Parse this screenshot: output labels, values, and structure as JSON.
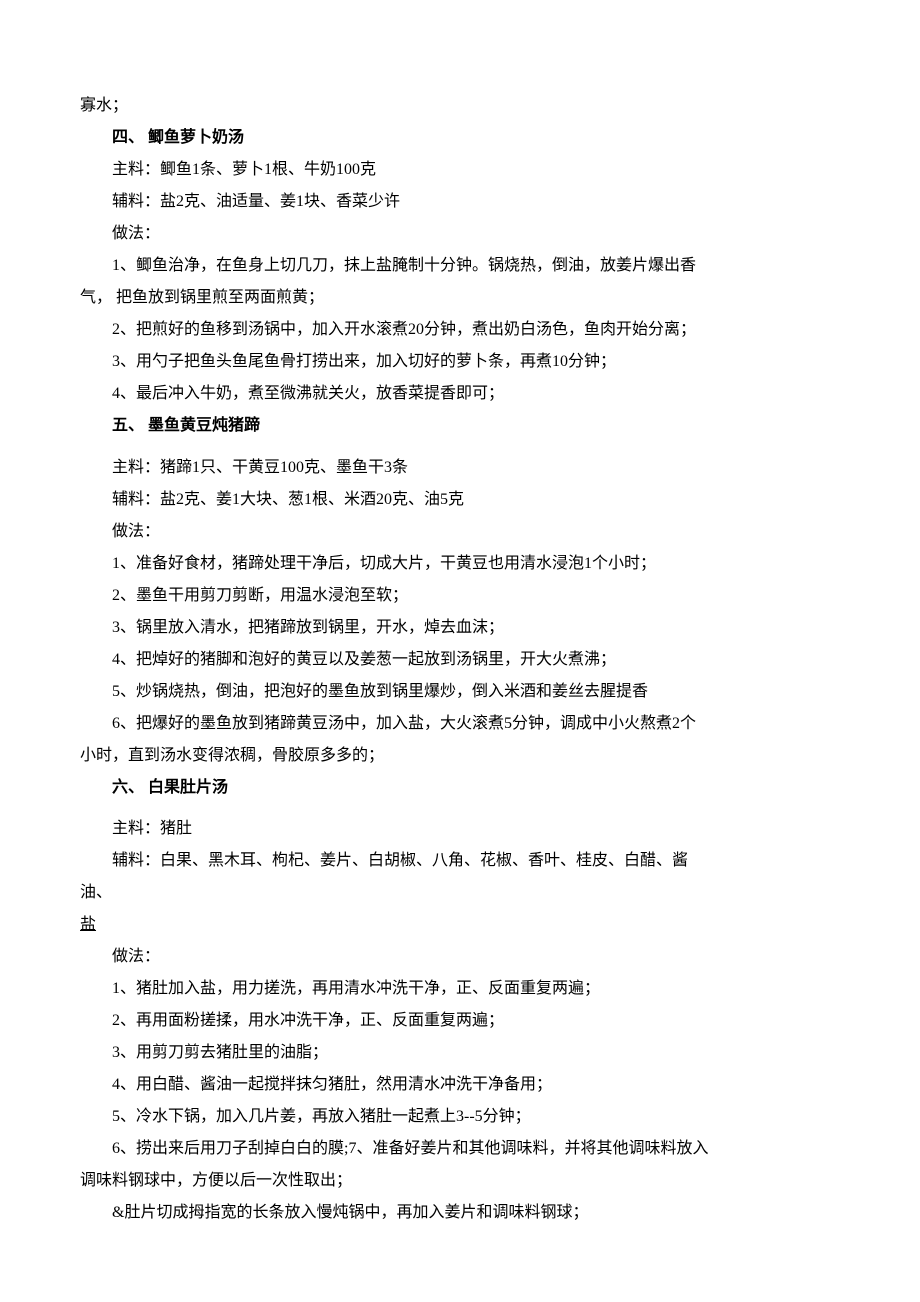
{
  "fragment_top": "寡水；",
  "section4": {
    "title": "四、   鲫鱼萝卜奶汤",
    "main": "主料：鲫鱼1条、萝卜1根、牛奶100克",
    "aux": "辅料：盐2克、油适量、姜1块、香菜少许",
    "method_label": "做法：",
    "steps": [
      "1、鲫鱼治净，在鱼身上切几刀，抹上盐腌制十分钟。锅烧热，倒油，放姜片爆出香",
      "气，  把鱼放到锅里煎至两面煎黄；",
      "2、把煎好的鱼移到汤锅中，加入开水滚煮20分钟，煮出奶白汤色，鱼肉开始分离；",
      "3、用勺子把鱼头鱼尾鱼骨打捞出来，加入切好的萝卜条，再煮10分钟；",
      "4、最后冲入牛奶，煮至微沸就关火，放香菜提香即可；"
    ]
  },
  "section5": {
    "title": "五、   墨鱼黄豆炖猪蹄",
    "main": "主料：猪蹄1只、干黄豆100克、墨鱼干3条",
    "aux": "辅料：盐2克、姜1大块、葱1根、米酒20克、油5克",
    "method_label": "做法：",
    "steps": [
      "1、准备好食材，猪蹄处理干净后，切成大片，干黄豆也用清水浸泡1个小时；",
      "2、墨鱼干用剪刀剪断，用温水浸泡至软；",
      "3、锅里放入清水，把猪蹄放到锅里，开水，焯去血沫；",
      "4、把焯好的猪脚和泡好的黄豆以及姜葱一起放到汤锅里，开大火煮沸；",
      "5、炒锅烧热，倒油，把泡好的墨鱼放到锅里爆炒，倒入米酒和姜丝去腥提香",
      "6、把爆好的墨鱼放到猪蹄黄豆汤中，加入盐，大火滚煮5分钟，调成中小火熬煮2个",
      "小时，直到汤水变得浓稠，骨胶原多多的；"
    ]
  },
  "section6": {
    "title": "六、   白果肚片汤",
    "main": "主料：猪肚",
    "aux_line1": "辅料：白果、黑木耳、枸杞、姜片、白胡椒、八角、花椒、香叶、桂皮、白醋、酱",
    "aux_line2": "油、",
    "aux_line3": "盐",
    "method_label": "做法：",
    "steps": [
      "1、猪肚加入盐，用力搓洗，再用清水冲洗干净，正、反面重复两遍；",
      "2、再用面粉搓揉，用水冲洗干净，正、反面重复两遍；",
      "3、用剪刀剪去猪肚里的油脂；",
      "4、用白醋、酱油一起搅拌抹匀猪肚，然用清水冲洗干净备用；",
      "5、冷水下锅，加入几片姜，再放入猪肚一起煮上3--5分钟；",
      "6、捞出来后用刀子刮掉白白的膜;7、准备好姜片和其他调味料，并将其他调味料放入",
      "调味料钢球中，方便以后一次性取出；",
      "&肚片切成拇指宽的长条放入慢炖锅中，再加入姜片和调味料钢球；"
    ]
  }
}
